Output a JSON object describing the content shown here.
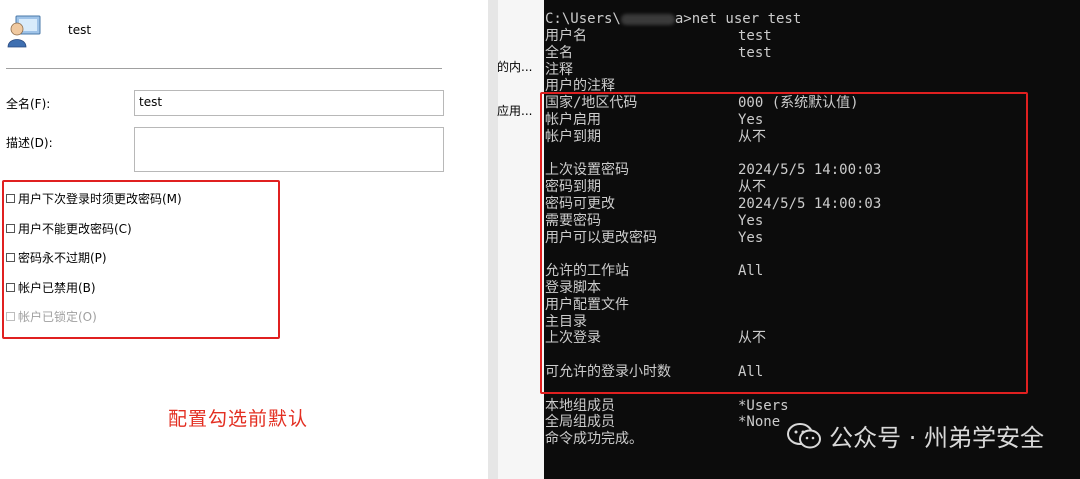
{
  "dialog": {
    "user_name": "test",
    "fullname_label": "全名(F):",
    "fullname_value": "test",
    "description_label": "描述(D):",
    "description_value": "",
    "checkboxes": [
      {
        "label": "用户下次登录时须更改密码(M)",
        "checked": false,
        "enabled": true
      },
      {
        "label": "用户不能更改密码(C)",
        "checked": false,
        "enabled": true
      },
      {
        "label": "密码永不过期(P)",
        "checked": false,
        "enabled": true
      },
      {
        "label": "帐户已禁用(B)",
        "checked": false,
        "enabled": true
      },
      {
        "label": "帐户已锁定(O)",
        "checked": false,
        "enabled": false
      }
    ],
    "caption": "配置勾选前默认"
  },
  "middle": {
    "items": [
      "的内...",
      "应用..."
    ]
  },
  "terminal": {
    "command_prefix": "C:\\Users\\",
    "command_suffix": "a>net user test",
    "lines": [
      {
        "k": "用户名",
        "v": "test"
      },
      {
        "k": "全名",
        "v": "test"
      },
      {
        "k": "注释",
        "v": ""
      },
      {
        "k": "用户的注释",
        "v": ""
      },
      {
        "k": "国家/地区代码",
        "v": "000 (系统默认值)"
      },
      {
        "k": "帐户启用",
        "v": "Yes"
      },
      {
        "k": "帐户到期",
        "v": "从不"
      },
      {
        "k": "",
        "v": ""
      },
      {
        "k": "上次设置密码",
        "v": "2024/5/5 14:00:03"
      },
      {
        "k": "密码到期",
        "v": "从不"
      },
      {
        "k": "密码可更改",
        "v": "2024/5/5 14:00:03"
      },
      {
        "k": "需要密码",
        "v": "Yes"
      },
      {
        "k": "用户可以更改密码",
        "v": "Yes"
      },
      {
        "k": "",
        "v": ""
      },
      {
        "k": "允许的工作站",
        "v": "All"
      },
      {
        "k": "登录脚本",
        "v": ""
      },
      {
        "k": "用户配置文件",
        "v": ""
      },
      {
        "k": "主目录",
        "v": ""
      },
      {
        "k": "上次登录",
        "v": "从不"
      },
      {
        "k": "",
        "v": ""
      },
      {
        "k": "可允许的登录小时数",
        "v": "All"
      },
      {
        "k": "",
        "v": ""
      },
      {
        "k": "本地组成员",
        "v": "*Users"
      },
      {
        "k": "全局组成员",
        "v": "*None"
      },
      {
        "k": "命令成功完成。",
        "v": ""
      }
    ],
    "watermark": "公众号 · 州弟学安全"
  },
  "colors": {
    "highlight": "#e02020",
    "caption": "#e32f22",
    "terminal_bg": "#0c0c0c",
    "terminal_fg": "#cccccc"
  }
}
